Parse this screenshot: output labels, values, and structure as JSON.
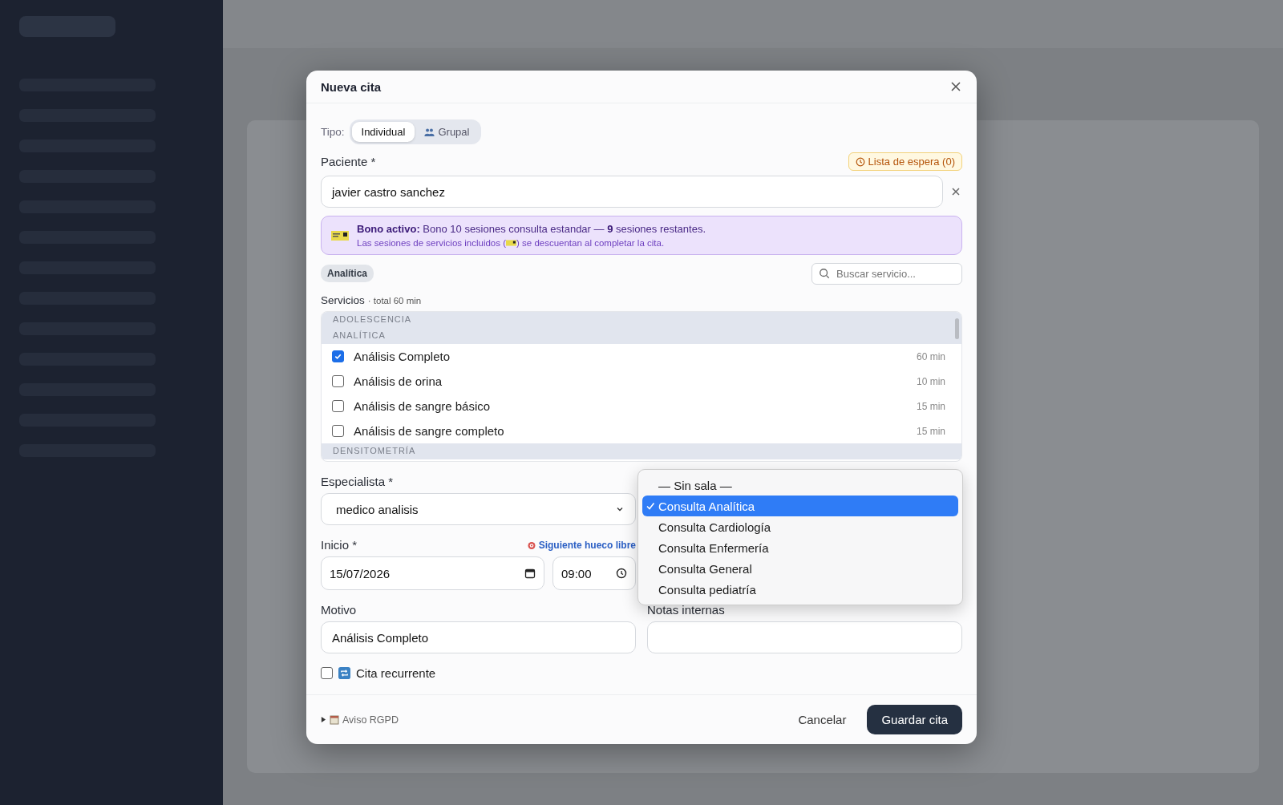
{
  "dialog": {
    "title": "Nueva cita"
  },
  "type_toggle": {
    "label": "Tipo:",
    "options": [
      {
        "label": "Individual",
        "kind": "single",
        "selected": true
      },
      {
        "label": "Grupal",
        "kind": "group",
        "selected": false
      }
    ]
  },
  "patient": {
    "label": "Paciente *",
    "waitlist": "Lista de espera (0)",
    "value": "javier castro sanchez"
  },
  "bono": {
    "text": "**Bono activo:** Bono 10 sesiones consulta estandar — **9** sesiones restantes.",
    "note_before": "Las sesiones de servicios incluidos (",
    "note_after": ") se descuentan al completar la cita."
  },
  "filter_chip": "Analítica",
  "service_search": {
    "placeholder": "Buscar servicio..."
  },
  "services": {
    "label": "Servicios",
    "total": "· total 60 min",
    "groups": [
      {
        "name": "ADOLESCENCIA"
      },
      {
        "name": "ANALÍTICA",
        "items": [
          {
            "name": "Análisis Completo",
            "duration": "60 min",
            "checked": true
          },
          {
            "name": "Análisis de orina",
            "duration": "10 min",
            "checked": false
          },
          {
            "name": "Análisis de sangre básico",
            "duration": "15 min",
            "checked": false
          },
          {
            "name": "Análisis de sangre completo",
            "duration": "15 min",
            "checked": false
          }
        ]
      },
      {
        "name": "DENSITOMETRÍA"
      }
    ]
  },
  "specialist": {
    "label": "Especialista *",
    "value": "medico analisis"
  },
  "room_menu": {
    "options": [
      {
        "label": "— Sin sala —",
        "selected": false
      },
      {
        "label": "Consulta Analítica",
        "selected": true
      },
      {
        "label": "Consulta Cardiología",
        "selected": false
      },
      {
        "label": "Consulta Enfermería",
        "selected": false
      },
      {
        "label": "Consulta General",
        "selected": false
      },
      {
        "label": "Consulta pediatría",
        "selected": false
      }
    ]
  },
  "start": {
    "label": "Inicio *",
    "next_slot": "Siguiente hueco libre",
    "date": "15/07/2026",
    "time": "09:00"
  },
  "reason": {
    "label": "Motivo",
    "value": "Análisis Completo"
  },
  "notes": {
    "label": "Notas internas"
  },
  "recurring": {
    "label": "Cita recurrente",
    "checked": false
  },
  "gdpr": {
    "label": "Aviso RGPD",
    "expanded": false
  },
  "buttons": {
    "cancel": "Cancelar",
    "save": "Guardar cita"
  }
}
